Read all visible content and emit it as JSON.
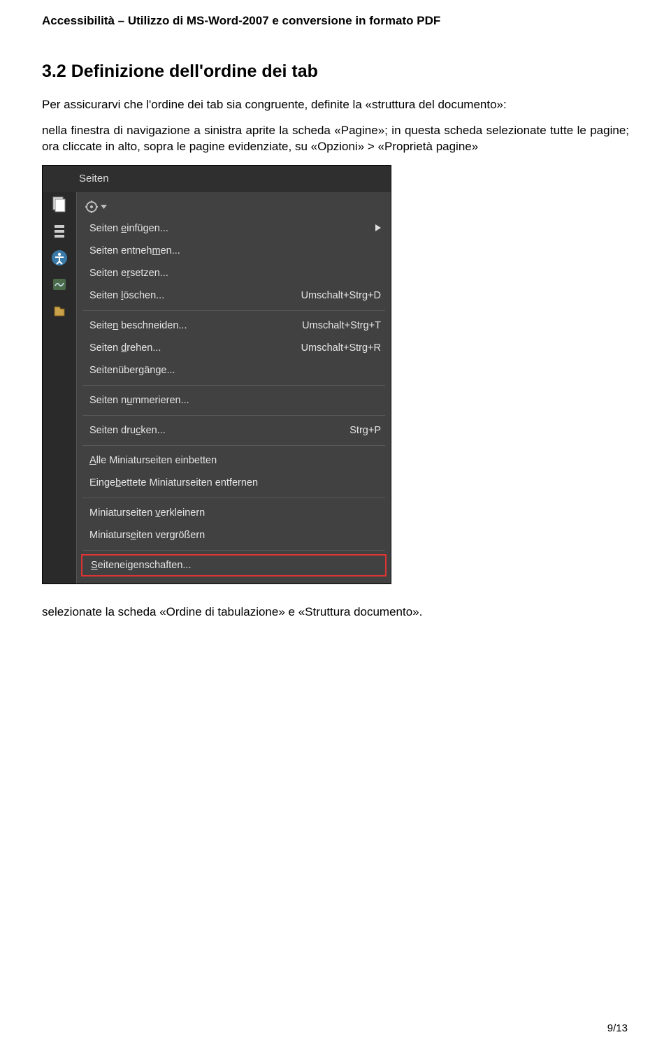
{
  "doc_header": "Accessibilità – Utilizzo di MS-Word-2007 e conversione in formato PDF",
  "section_heading": "3.2   Definizione dell'ordine dei tab",
  "para1": "Per assicurarvi che l'ordine dei tab sia congruente, definite la «struttura del documento»:",
  "para2": "nella finestra di navigazione a sinistra aprite la scheda «Pagine»; in questa scheda selezionate tutte le pagine; ora cliccate in alto, sopra le pagine evidenziate, su «Opzioni» > «Proprietà pagine»",
  "panel_title": "Seiten",
  "menu": {
    "items": [
      {
        "label_pre": "Seiten ",
        "u": "e",
        "label_post": "infügen...",
        "shortcut": "",
        "submenu": true
      },
      {
        "label_pre": "Seiten entneh",
        "u": "m",
        "label_post": "en...",
        "shortcut": ""
      },
      {
        "label_pre": "Seiten e",
        "u": "r",
        "label_post": "setzen...",
        "shortcut": ""
      },
      {
        "label_pre": "Seiten ",
        "u": "l",
        "label_post": "öschen...",
        "shortcut": "Umschalt+Strg+D"
      }
    ],
    "group2": [
      {
        "label_pre": "Seite",
        "u": "n",
        "label_post": " beschneiden...",
        "shortcut": "Umschalt+Strg+T"
      },
      {
        "label_pre": "Seiten ",
        "u": "d",
        "label_post": "rehen...",
        "shortcut": "Umschalt+Strg+R"
      },
      {
        "label_pre": "Seitenüber",
        "u": "g",
        "label_post": "änge...",
        "shortcut": ""
      }
    ],
    "group3": [
      {
        "label_pre": "Seiten n",
        "u": "u",
        "label_post": "mmerieren...",
        "shortcut": ""
      }
    ],
    "group4": [
      {
        "label_pre": "Seiten dru",
        "u": "c",
        "label_post": "ken...",
        "shortcut": "Strg+P"
      }
    ],
    "group5": [
      {
        "label_pre": "",
        "u": "A",
        "label_post": "lle Miniaturseiten einbetten",
        "shortcut": ""
      },
      {
        "label_pre": "Einge",
        "u": "b",
        "label_post": "ettete Miniaturseiten entfernen",
        "shortcut": ""
      }
    ],
    "group6": [
      {
        "label_pre": "Miniaturseiten ",
        "u": "v",
        "label_post": "erkleinern",
        "shortcut": ""
      },
      {
        "label_pre": "Miniaturs",
        "u": "e",
        "label_post": "iten vergrößern",
        "shortcut": ""
      }
    ],
    "highlighted": {
      "label_pre": "",
      "u": "S",
      "label_post": "eiteneigenschaften...",
      "shortcut": ""
    }
  },
  "footer_text": "selezionate la scheda «Ordine di tabulazione» e «Struttura documento».",
  "page_num": "9/13"
}
